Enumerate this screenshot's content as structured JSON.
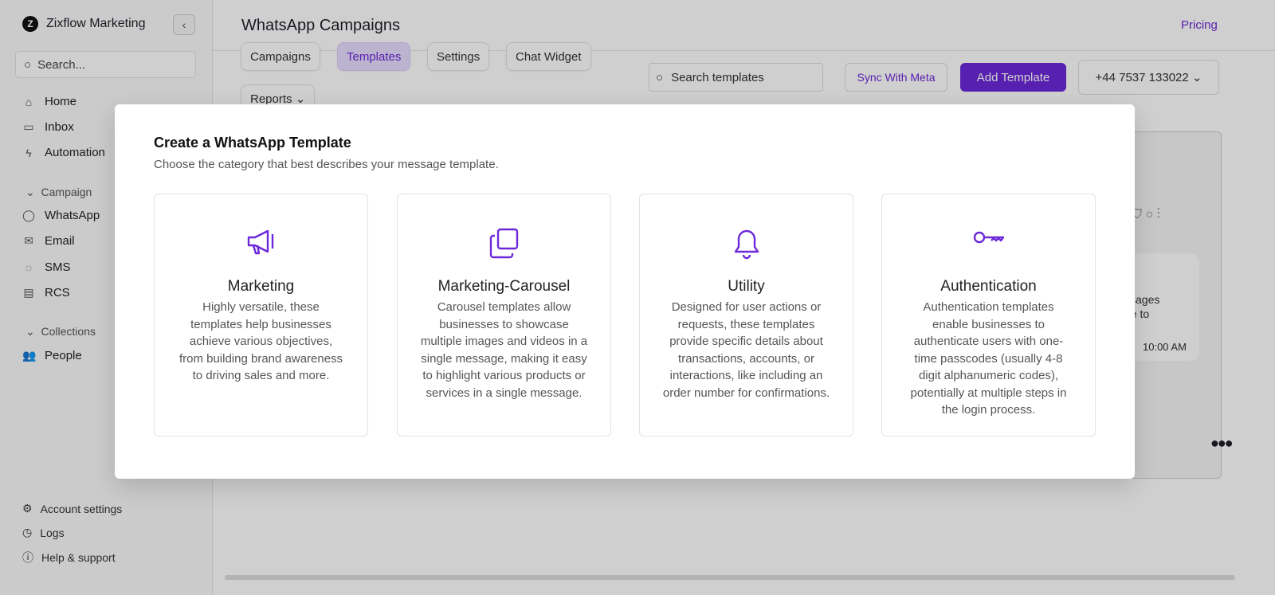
{
  "sidebar": {
    "brand": "Zixflow Marketing",
    "search_placeholder": "Search...",
    "nav": [
      {
        "label": "Home"
      },
      {
        "label": "Inbox"
      },
      {
        "label": "Automation"
      }
    ],
    "campaign_section": "Campaign",
    "campaign_items": [
      {
        "label": "WhatsApp"
      },
      {
        "label": "Email"
      },
      {
        "label": "SMS"
      },
      {
        "label": "RCS"
      }
    ],
    "collections_section": "Collections",
    "collections_items": [
      {
        "label": "People"
      }
    ],
    "footer": [
      {
        "label": "Account settings"
      },
      {
        "label": "Logs"
      },
      {
        "label": "Help & support"
      }
    ]
  },
  "header": {
    "title": "WhatsApp Campaigns",
    "pricing": "Pricing"
  },
  "tabs": [
    {
      "label": "Campaigns"
    },
    {
      "label": "Templates"
    },
    {
      "label": "Settings"
    },
    {
      "label": "Chat Widget"
    },
    {
      "label": "Reports"
    }
  ],
  "toolbar": {
    "search_placeholder": "Search templates",
    "sync": "Sync With Meta",
    "add": "Add Template",
    "phone": "+44 7537 133022"
  },
  "preview": {
    "text1": "ssages",
    "text2": "ue to",
    "time": "10:00 AM"
  },
  "modal": {
    "title": "Create a WhatsApp Template",
    "subtitle": "Choose the category that best describes your message template.",
    "cards": [
      {
        "title": "Marketing",
        "desc": "Highly versatile, these templates help businesses achieve various objectives, from building brand awareness to driving sales and more."
      },
      {
        "title": "Marketing-Carousel",
        "desc": "Carousel templates allow businesses to showcase multiple images and videos in a single message, making it easy to highlight various products or services in a single message."
      },
      {
        "title": "Utility",
        "desc": "Designed for user actions or requests, these templates provide specific details about transactions, accounts, or interactions, like including an order number for confirmations."
      },
      {
        "title": "Authentication",
        "desc": "Authentication templates enable businesses to authenticate users with one-time passcodes (usually 4-8 digit alphanumeric codes), potentially at multiple steps in the login process."
      }
    ]
  },
  "colors": {
    "accent": "#6d28d9"
  }
}
